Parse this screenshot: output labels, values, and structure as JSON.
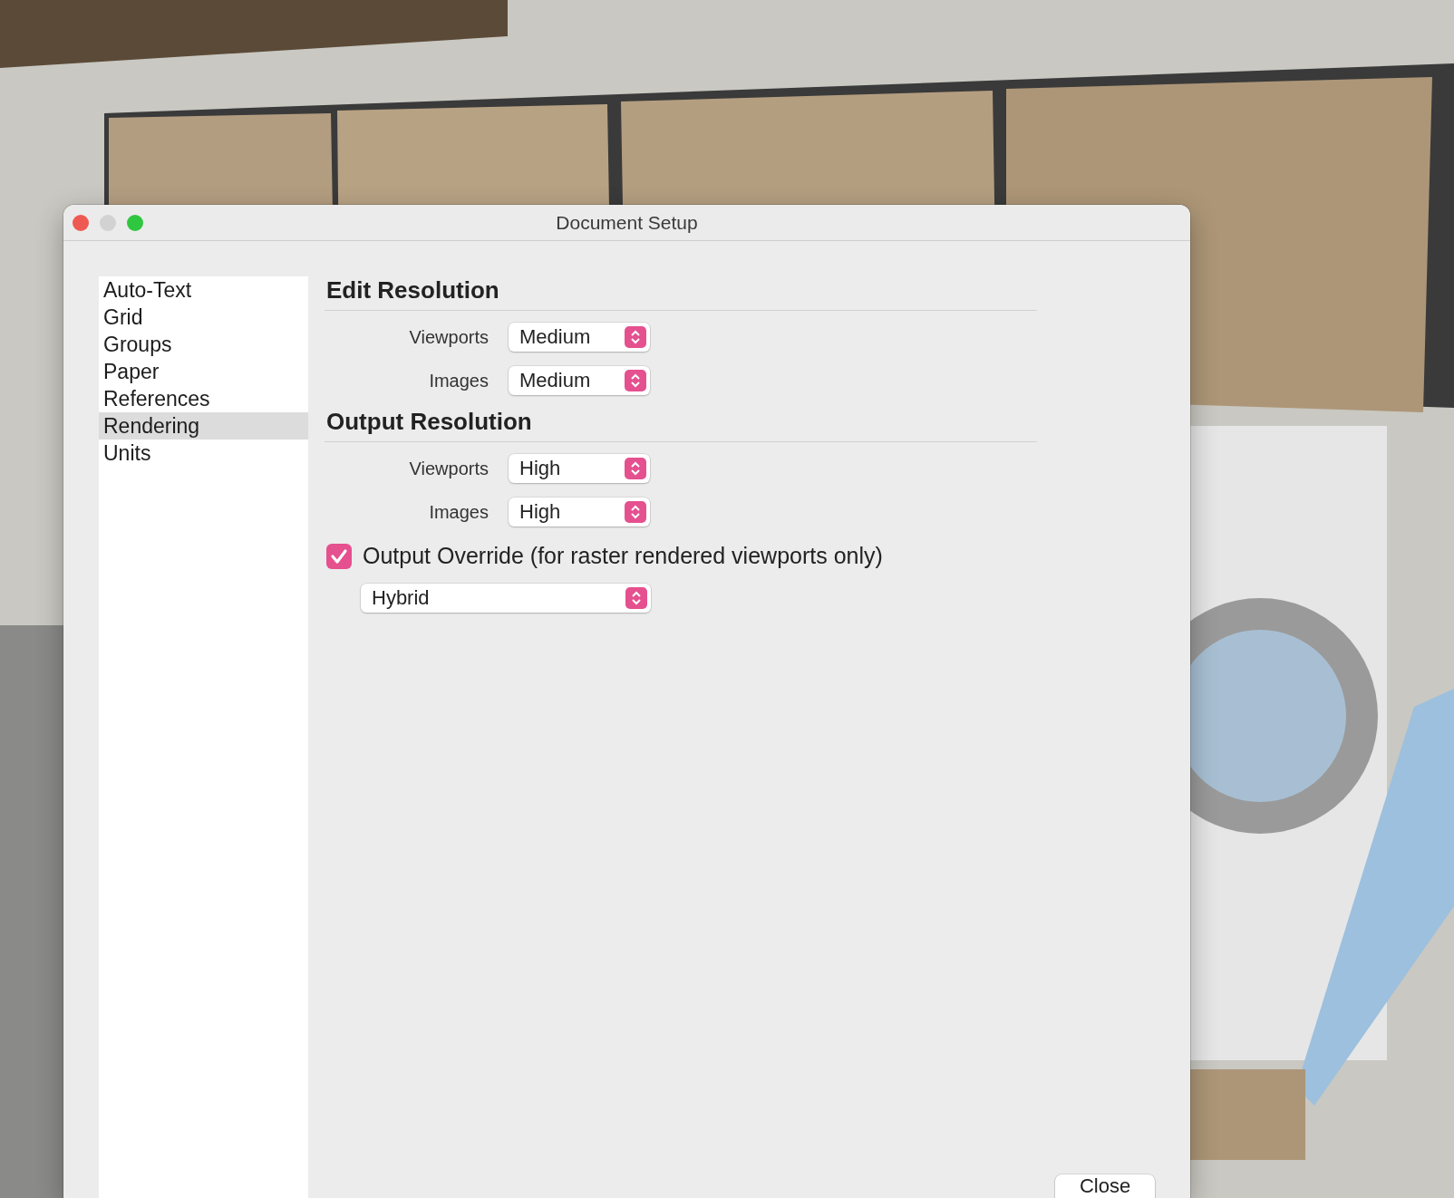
{
  "window": {
    "title": "Document Setup"
  },
  "sidebar": {
    "items": [
      {
        "label": "Auto-Text",
        "selected": false
      },
      {
        "label": "Grid",
        "selected": false
      },
      {
        "label": "Groups",
        "selected": false
      },
      {
        "label": "Paper",
        "selected": false
      },
      {
        "label": "References",
        "selected": false
      },
      {
        "label": "Rendering",
        "selected": true
      },
      {
        "label": "Units",
        "selected": false
      }
    ]
  },
  "sections": [
    {
      "title": "Edit Resolution",
      "rows": [
        {
          "label": "Viewports",
          "value": "Medium"
        },
        {
          "label": "Images",
          "value": "Medium"
        }
      ]
    },
    {
      "title": "Output Resolution",
      "rows": [
        {
          "label": "Viewports",
          "value": "High"
        },
        {
          "label": "Images",
          "value": "High"
        }
      ]
    }
  ],
  "output_override": {
    "label": "Output Override (for raster rendered viewports only)",
    "checked": true,
    "value": "Hybrid"
  },
  "buttons": [
    "Close"
  ]
}
